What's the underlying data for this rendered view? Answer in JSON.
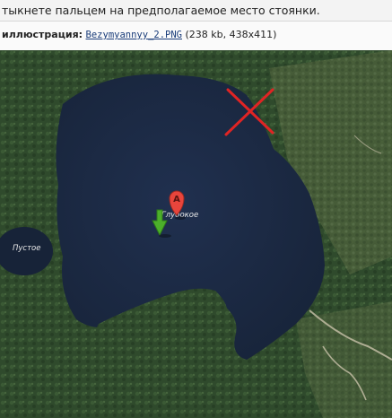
{
  "post": {
    "text_fragment": "тыкнете пальцем на предполагаемое место стоянки."
  },
  "attachment": {
    "label": "иллюстрация:",
    "filename": "Bezymyannyy_2.PNG",
    "meta": "(238 kb, 438x411)"
  },
  "map": {
    "lake_main_label": "Глубокое",
    "lake_small_label": "Пустое",
    "marker_letter": "A",
    "marker_color": "#e8453c",
    "arrow_color": "#4caf2a",
    "cross_color": "#e02424",
    "water_color": "#1c2a44",
    "forest_color": "#2f4a2c"
  }
}
